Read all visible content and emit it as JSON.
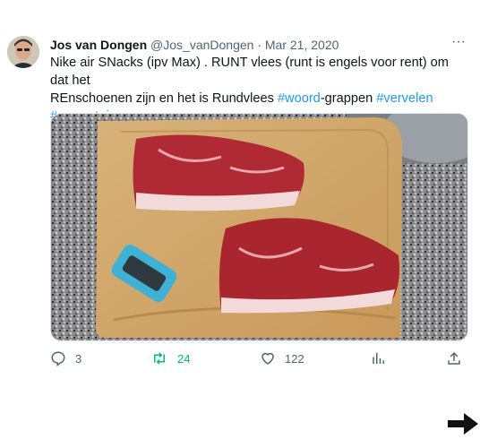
{
  "tweet": {
    "author": {
      "name": "Jos van Dongen",
      "handle": "@Jos_vanDongen",
      "separator": "·",
      "date": "Mar 21, 2020"
    },
    "more_label": "···",
    "text_segments": [
      "Nike air SNacks (ipv Max) . RUNT vlees (runt is engels voor rent) om dat het",
      "REnschoenen zijn en het is Rundvlees ",
      "#woord",
      "-grappen ",
      "#vervelen",
      "#qarranteine"
    ],
    "media": {
      "description_icon": "photo-steaks-on-cutting-board"
    },
    "actions": {
      "reply_count": "3",
      "retweet_count": "24",
      "like_count": "122",
      "views_icon": "analytics-icon",
      "share_icon": "share-icon"
    }
  },
  "overlay": {
    "arrow_icon": "arrow-right-icon"
  },
  "colors": {
    "link": "#1d9bf0",
    "retweet": "#00ba7c",
    "muted": "#536471"
  }
}
